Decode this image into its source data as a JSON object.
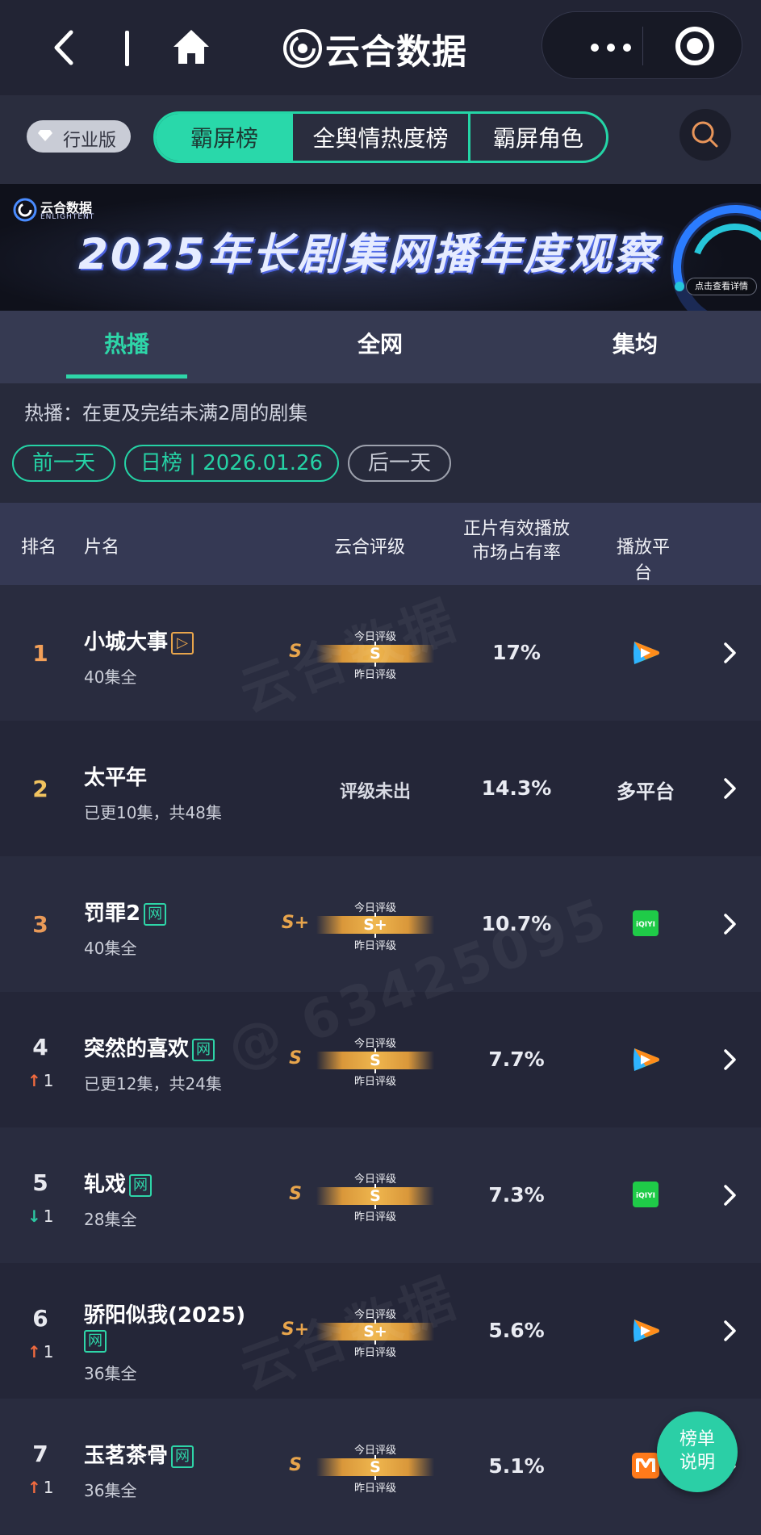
{
  "topbar": {
    "title": "云合数据"
  },
  "category": {
    "edition_label": "行业版",
    "segments": [
      "霸屏榜",
      "全舆情热度榜",
      "霸屏角色"
    ]
  },
  "banner": {
    "brand": "云合数据",
    "brand_en": "ENLIGHTENT",
    "title": "2025年长剧集网播年度观察",
    "cta": "点击查看详情"
  },
  "subtabs": [
    "热播",
    "全网",
    "集均"
  ],
  "description": "热播：在更及完结未满2周的剧集",
  "date_nav": {
    "prev": "前一天",
    "date": "日榜 | 2026.01.26",
    "next": "后一天"
  },
  "table": {
    "headers": {
      "rank": "排名",
      "name": "片名",
      "rating": "云合评级",
      "share_line1": "正片有效播放",
      "share_line2": "市场占有率",
      "platform": "播放平台"
    },
    "gauge_top": "今日评级",
    "gauge_bottom": "昨日评级",
    "rows": [
      {
        "rank": "1",
        "change": "",
        "name": "小城大事",
        "tag": "▷",
        "episodes": "40集全",
        "prev_rating": "S",
        "rating": "S",
        "share": "17%",
        "platform": "tencent-video"
      },
      {
        "rank": "2",
        "change": "",
        "name": "太平年",
        "tag": "",
        "episodes": "已更10集，共48集",
        "prev_rating": "",
        "rating": "评级未出",
        "share": "14.3%",
        "platform": "多平台"
      },
      {
        "rank": "3",
        "change": "",
        "name": "罚罪2",
        "tag": "网",
        "episodes": "40集全",
        "prev_rating": "S+",
        "rating": "S+",
        "share": "10.7%",
        "platform": "iqiyi"
      },
      {
        "rank": "4",
        "change": "1",
        "name": "突然的喜欢",
        "tag": "网",
        "episodes": "已更12集，共24集",
        "prev_rating": "S",
        "rating": "S",
        "share": "7.7%",
        "platform": "tencent-video"
      },
      {
        "rank": "5",
        "change": "1",
        "name": "轧戏",
        "tag": "网",
        "episodes": "28集全",
        "prev_rating": "S",
        "rating": "S",
        "share": "7.3%",
        "platform": "iqiyi"
      },
      {
        "rank": "6",
        "change": "1",
        "name": "骄阳似我(2025)",
        "tag": "网",
        "episodes": "36集全",
        "prev_rating": "S+",
        "rating": "S+",
        "share": "5.6%",
        "platform": "tencent-video"
      },
      {
        "rank": "7",
        "change": "1",
        "name": "玉茗茶骨",
        "tag": "网",
        "episodes": "36集全",
        "prev_rating": "S",
        "rating": "S",
        "share": "5.1%",
        "platform": "mango-tv"
      }
    ]
  },
  "fab": {
    "line1": "榜单",
    "line2": "说明"
  },
  "watermark": "@ 63425095",
  "colors": {
    "accent": "#29d8aa",
    "gold": "#e8a54c",
    "up": "#f26b3f",
    "down": "#2cc8a2",
    "iqiyi": "#1fcb48"
  }
}
